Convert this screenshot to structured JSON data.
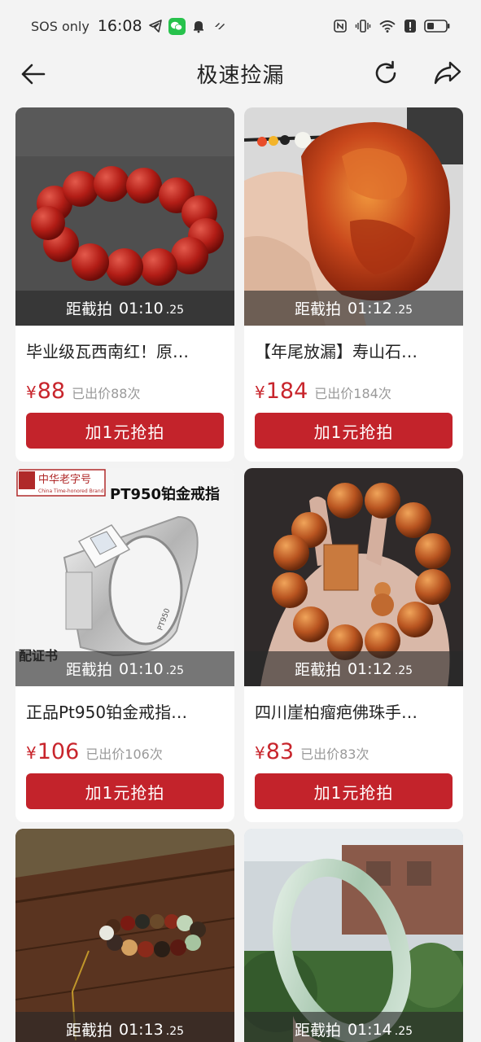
{
  "status_bar": {
    "carrier": "SOS only",
    "time": "16:08"
  },
  "header": {
    "title": "极速捡漏"
  },
  "labels": {
    "countdown_prefix": "距截拍",
    "bid_button": "加1元抢拍"
  },
  "products": [
    {
      "title": "毕业级瓦西南红！原…",
      "countdown": "01:10",
      "countdown_ms": ".25",
      "price": "88",
      "bids": "已出价88次",
      "image": "red-agate-bead-bracelet"
    },
    {
      "title": "【年尾放漏】寿山石…",
      "countdown": "01:12",
      "countdown_ms": ".25",
      "price": "184",
      "bids": "已出价184次",
      "image": "shoushan-stone-pixiu-carving"
    },
    {
      "title": "正品Pt950铂金戒指…",
      "countdown": "01:10",
      "countdown_ms": ".25",
      "price": "106",
      "bids": "已出价106次",
      "image": "platinum-ring",
      "image_text": {
        "brand": "中华老字号",
        "brand_en": "China Time-honored Brand",
        "caption": "PT950铂金戒指",
        "ring_mark": "PT950",
        "cert": "配证书"
      }
    },
    {
      "title": "四川崖柏瘤疤佛珠手…",
      "countdown": "01:12",
      "countdown_ms": ".25",
      "price": "83",
      "bids": "已出价83次",
      "image": "cypress-wood-bead-bracelet"
    },
    {
      "title": "",
      "countdown": "01:13",
      "countdown_ms": ".25",
      "image": "multi-bead-bracelet-on-wood"
    },
    {
      "title": "",
      "countdown": "01:14",
      "countdown_ms": ".25",
      "image": "jade-bangle"
    }
  ],
  "colors": {
    "accent": "#c3232b",
    "price": "#c8252c",
    "background": "#f3f3f3"
  }
}
